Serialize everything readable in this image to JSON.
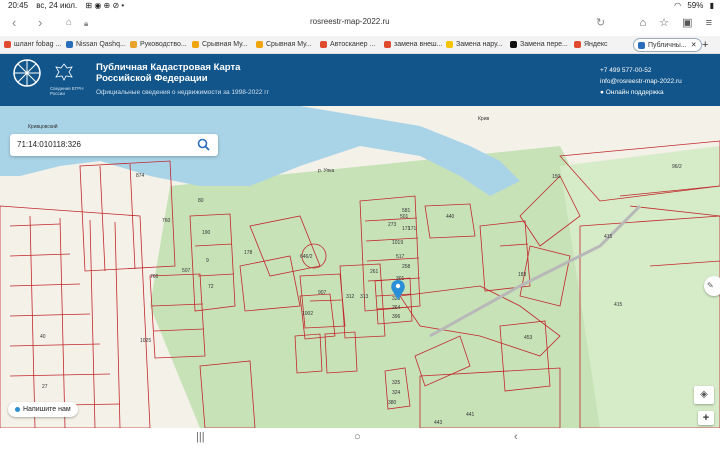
{
  "status": {
    "time": "20:45",
    "date": "вс, 24 июл.",
    "battery": "59%"
  },
  "browser": {
    "url": "rosreestr-map-2022.ru",
    "tab_count": "11",
    "tabs": [
      {
        "label": "шланг fobag ...",
        "color": "#e04b2f"
      },
      {
        "label": "Nissan Qashq...",
        "color": "#2a6ebb"
      },
      {
        "label": "Руководство...",
        "color": "#e8a32c"
      },
      {
        "label": "Срывная Му...",
        "color": "#f0a30a"
      },
      {
        "label": "Срывная Му...",
        "color": "#f0a30a"
      },
      {
        "label": "Автосканер ...",
        "color": "#e04b2f"
      },
      {
        "label": "замена внеш...",
        "color": "#e04b2f"
      },
      {
        "label": "Замена нару...",
        "color": "#f5c400"
      },
      {
        "label": "Замена пере...",
        "color": "#111111"
      },
      {
        "label": "Яндекс",
        "color": "#e04b2f"
      },
      {
        "label": "Публичны...",
        "color": "#2a6ebb"
      }
    ]
  },
  "header": {
    "logo_caption": "Сведения ЕГРН России",
    "title_line1": "Публичная Кадастровая Карта",
    "title_line2": "Российской Федерации",
    "subtitle": "Официальные сведения о недвижимости за 1998-2022 гг",
    "phone": "+7 499 577-00-52",
    "email": "info@rosreestr-map-2022.ru",
    "support": "Онлайн поддержка"
  },
  "search": {
    "value": "71:14:010118:326"
  },
  "map": {
    "labels": {
      "village_left": "Кривцовский",
      "village_right": "Крив",
      "river": "р. Упка"
    },
    "lots": [
      "874",
      "581",
      "80",
      "190",
      "171",
      "9",
      "72",
      "760",
      "273",
      "501",
      "171",
      "1019",
      "440",
      "415",
      "517",
      "258",
      "261",
      "907",
      "326",
      "264",
      "396",
      "301",
      "1002",
      "183",
      "453",
      "415",
      "178",
      "1025",
      "40",
      "27",
      "325",
      "324",
      "441",
      "443",
      "380",
      "312",
      "313",
      "760",
      "507",
      "646/2",
      "150",
      "96/2"
    ]
  },
  "write_us": "Напишите нам",
  "colors": {
    "header_bg": "#12558a",
    "water": "#a9d4e8",
    "forest": "#c8e2b8",
    "parcel": "#c0282d",
    "marker": "#2a8fd6"
  }
}
